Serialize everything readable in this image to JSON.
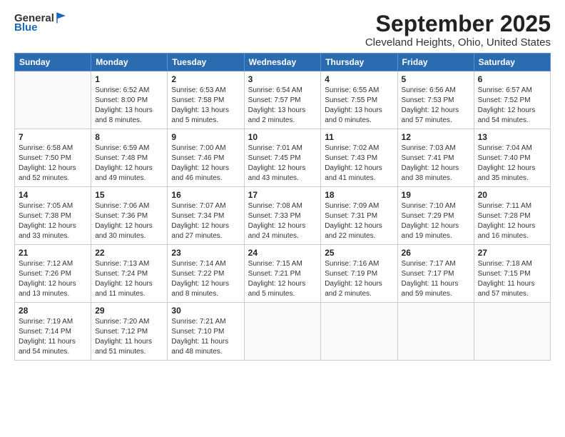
{
  "header": {
    "logo_general": "General",
    "logo_blue": "Blue",
    "month": "September 2025",
    "location": "Cleveland Heights, Ohio, United States"
  },
  "days_of_week": [
    "Sunday",
    "Monday",
    "Tuesday",
    "Wednesday",
    "Thursday",
    "Friday",
    "Saturday"
  ],
  "weeks": [
    [
      {
        "day": "",
        "info": ""
      },
      {
        "day": "1",
        "info": "Sunrise: 6:52 AM\nSunset: 8:00 PM\nDaylight: 13 hours\nand 8 minutes."
      },
      {
        "day": "2",
        "info": "Sunrise: 6:53 AM\nSunset: 7:58 PM\nDaylight: 13 hours\nand 5 minutes."
      },
      {
        "day": "3",
        "info": "Sunrise: 6:54 AM\nSunset: 7:57 PM\nDaylight: 13 hours\nand 2 minutes."
      },
      {
        "day": "4",
        "info": "Sunrise: 6:55 AM\nSunset: 7:55 PM\nDaylight: 13 hours\nand 0 minutes."
      },
      {
        "day": "5",
        "info": "Sunrise: 6:56 AM\nSunset: 7:53 PM\nDaylight: 12 hours\nand 57 minutes."
      },
      {
        "day": "6",
        "info": "Sunrise: 6:57 AM\nSunset: 7:52 PM\nDaylight: 12 hours\nand 54 minutes."
      }
    ],
    [
      {
        "day": "7",
        "info": "Sunrise: 6:58 AM\nSunset: 7:50 PM\nDaylight: 12 hours\nand 52 minutes."
      },
      {
        "day": "8",
        "info": "Sunrise: 6:59 AM\nSunset: 7:48 PM\nDaylight: 12 hours\nand 49 minutes."
      },
      {
        "day": "9",
        "info": "Sunrise: 7:00 AM\nSunset: 7:46 PM\nDaylight: 12 hours\nand 46 minutes."
      },
      {
        "day": "10",
        "info": "Sunrise: 7:01 AM\nSunset: 7:45 PM\nDaylight: 12 hours\nand 43 minutes."
      },
      {
        "day": "11",
        "info": "Sunrise: 7:02 AM\nSunset: 7:43 PM\nDaylight: 12 hours\nand 41 minutes."
      },
      {
        "day": "12",
        "info": "Sunrise: 7:03 AM\nSunset: 7:41 PM\nDaylight: 12 hours\nand 38 minutes."
      },
      {
        "day": "13",
        "info": "Sunrise: 7:04 AM\nSunset: 7:40 PM\nDaylight: 12 hours\nand 35 minutes."
      }
    ],
    [
      {
        "day": "14",
        "info": "Sunrise: 7:05 AM\nSunset: 7:38 PM\nDaylight: 12 hours\nand 33 minutes."
      },
      {
        "day": "15",
        "info": "Sunrise: 7:06 AM\nSunset: 7:36 PM\nDaylight: 12 hours\nand 30 minutes."
      },
      {
        "day": "16",
        "info": "Sunrise: 7:07 AM\nSunset: 7:34 PM\nDaylight: 12 hours\nand 27 minutes."
      },
      {
        "day": "17",
        "info": "Sunrise: 7:08 AM\nSunset: 7:33 PM\nDaylight: 12 hours\nand 24 minutes."
      },
      {
        "day": "18",
        "info": "Sunrise: 7:09 AM\nSunset: 7:31 PM\nDaylight: 12 hours\nand 22 minutes."
      },
      {
        "day": "19",
        "info": "Sunrise: 7:10 AM\nSunset: 7:29 PM\nDaylight: 12 hours\nand 19 minutes."
      },
      {
        "day": "20",
        "info": "Sunrise: 7:11 AM\nSunset: 7:28 PM\nDaylight: 12 hours\nand 16 minutes."
      }
    ],
    [
      {
        "day": "21",
        "info": "Sunrise: 7:12 AM\nSunset: 7:26 PM\nDaylight: 12 hours\nand 13 minutes."
      },
      {
        "day": "22",
        "info": "Sunrise: 7:13 AM\nSunset: 7:24 PM\nDaylight: 12 hours\nand 11 minutes."
      },
      {
        "day": "23",
        "info": "Sunrise: 7:14 AM\nSunset: 7:22 PM\nDaylight: 12 hours\nand 8 minutes."
      },
      {
        "day": "24",
        "info": "Sunrise: 7:15 AM\nSunset: 7:21 PM\nDaylight: 12 hours\nand 5 minutes."
      },
      {
        "day": "25",
        "info": "Sunrise: 7:16 AM\nSunset: 7:19 PM\nDaylight: 12 hours\nand 2 minutes."
      },
      {
        "day": "26",
        "info": "Sunrise: 7:17 AM\nSunset: 7:17 PM\nDaylight: 11 hours\nand 59 minutes."
      },
      {
        "day": "27",
        "info": "Sunrise: 7:18 AM\nSunset: 7:15 PM\nDaylight: 11 hours\nand 57 minutes."
      }
    ],
    [
      {
        "day": "28",
        "info": "Sunrise: 7:19 AM\nSunset: 7:14 PM\nDaylight: 11 hours\nand 54 minutes."
      },
      {
        "day": "29",
        "info": "Sunrise: 7:20 AM\nSunset: 7:12 PM\nDaylight: 11 hours\nand 51 minutes."
      },
      {
        "day": "30",
        "info": "Sunrise: 7:21 AM\nSunset: 7:10 PM\nDaylight: 11 hours\nand 48 minutes."
      },
      {
        "day": "",
        "info": ""
      },
      {
        "day": "",
        "info": ""
      },
      {
        "day": "",
        "info": ""
      },
      {
        "day": "",
        "info": ""
      }
    ]
  ]
}
